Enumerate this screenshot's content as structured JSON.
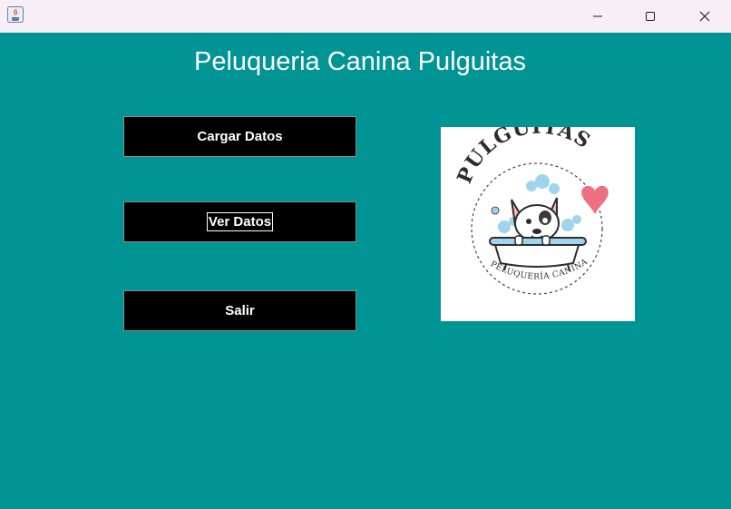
{
  "window": {
    "title": "",
    "controls": {
      "minimize": "minimize",
      "maximize": "maximize",
      "close": "close"
    }
  },
  "main": {
    "title": "Peluqueria Canina Pulguitas",
    "buttons": {
      "load": "Cargar Datos",
      "view": "Ver Datos",
      "exit": "Salir"
    },
    "logo": {
      "brand": "PULGUITAS",
      "subtitle": "PELUQUERÍA CANINA"
    }
  },
  "colors": {
    "background": "#009494",
    "button": "#000000",
    "titlebar": "#f8eef5",
    "heart": "#ee6f80",
    "bubbles": "#9fd4ee"
  },
  "icons": [
    "java-app-icon",
    "minimize-icon",
    "maximize-icon",
    "close-icon",
    "dog-in-bathtub-logo",
    "heart-icon"
  ]
}
